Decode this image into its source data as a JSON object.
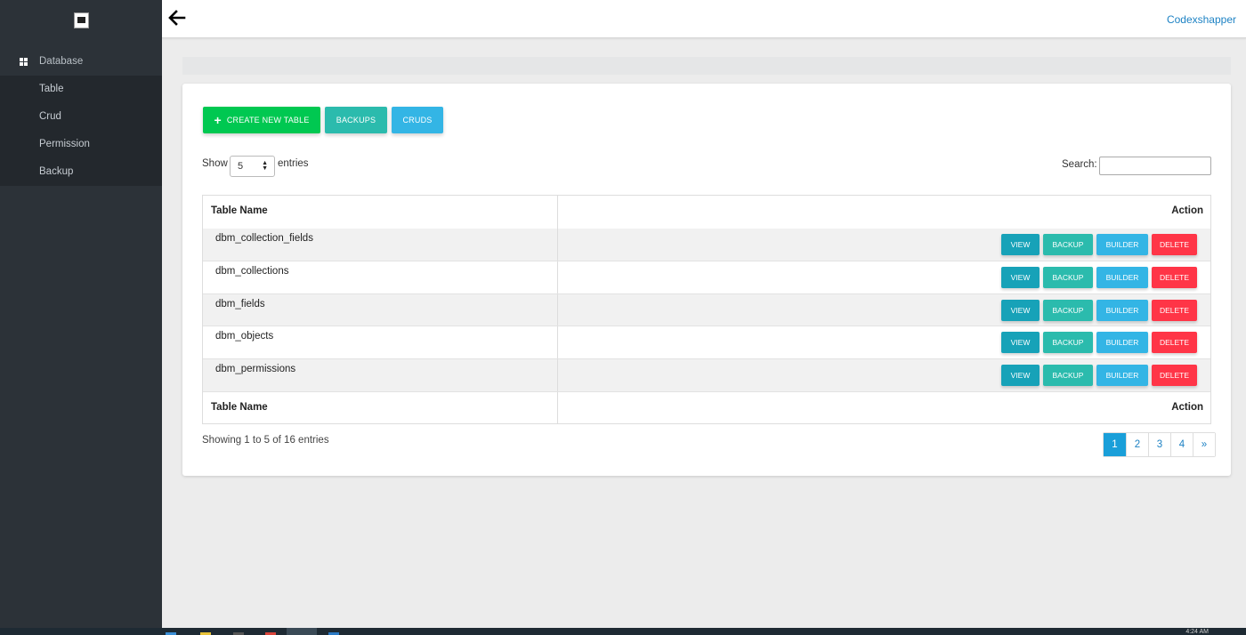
{
  "sidebar": {
    "items": [
      {
        "label": "Database"
      },
      {
        "label": "Table"
      },
      {
        "label": "Crud"
      },
      {
        "label": "Permission"
      },
      {
        "label": "Backup"
      }
    ]
  },
  "header": {
    "brand": "Codexshapper"
  },
  "toolbar": {
    "create_label": "CREATE NEW TABLE",
    "backups_label": "BACKUPS",
    "cruds_label": "CRUDS"
  },
  "controls": {
    "show_label": "Show",
    "length_value": "5",
    "entries_label": "entries",
    "search_label": "Search:",
    "search_value": ""
  },
  "table": {
    "columns": [
      "Table Name",
      "Action"
    ],
    "rows": [
      {
        "name": "dbm_collection_fields"
      },
      {
        "name": "dbm_collections"
      },
      {
        "name": "dbm_fields"
      },
      {
        "name": "dbm_objects"
      },
      {
        "name": "dbm_permissions"
      }
    ],
    "actions": {
      "view": "VIEW",
      "backup": "BACKUP",
      "builder": "BUILDER",
      "delete": "DELETE"
    }
  },
  "footer": {
    "info": "Showing 1 to 5 of 16 entries",
    "pages": [
      "1",
      "2",
      "3",
      "4",
      "»"
    ],
    "active_page": "1"
  },
  "taskbar": {
    "time": "4:24 AM"
  },
  "colors": {
    "sidebar_bg": "#2c3238",
    "create": "#00c851",
    "backups": "#2bbbad",
    "cruds": "#33b5e5",
    "view": "#17a2b8",
    "delete": "#ff3547",
    "link": "#1d82c4"
  }
}
